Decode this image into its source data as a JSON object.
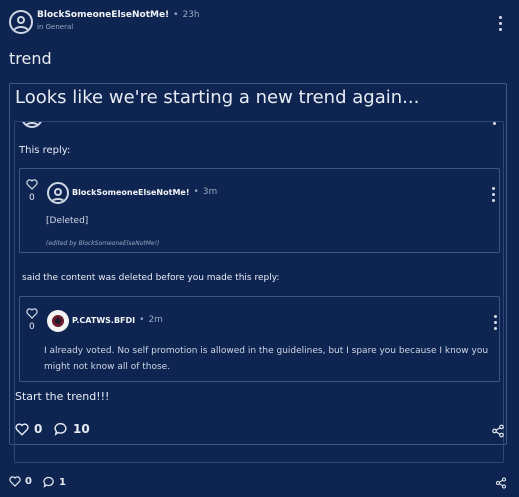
{
  "post": {
    "author": "BlockSomeoneElseNotMe!",
    "separator": "•",
    "time": "23h",
    "category": "in General",
    "title": "trend",
    "likes": "0",
    "comments": "1"
  },
  "quote": {
    "heading": "Looks like we're starting a new trend again...",
    "intro": "This reply:",
    "middle": "said the content was deleted before you made this reply:",
    "footer": "Start the trend!!!",
    "likes": "0",
    "comments": "10"
  },
  "reply1": {
    "votes": "0",
    "author": "BlockSomeoneElseNotMe!",
    "separator": "•",
    "time": "3m",
    "body": "[Deleted]",
    "edited": "(edited by BlockSomeoneElseNotMe!)"
  },
  "reply2": {
    "votes": "0",
    "author": "P.CATWS.BFDI",
    "separator": "•",
    "time": "2m",
    "body": "I already voted. No self promotion is allowed in the guidelines, but I spare you because I know you might not know all of those."
  },
  "colors": {
    "background": "#0e2552",
    "border": "#3d5688",
    "text": "#e8ecf4"
  }
}
